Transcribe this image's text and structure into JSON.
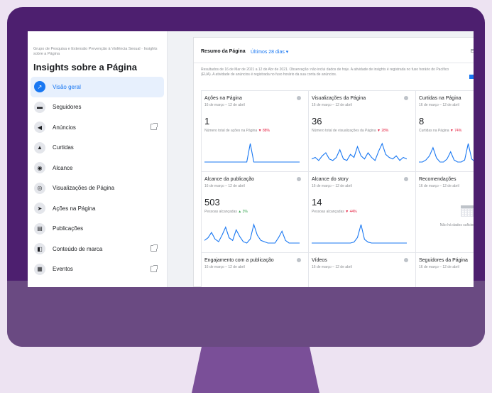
{
  "sidebar": {
    "breadcrumb": "Grupo de Pesquisa e Extensão Prevenção à Violência Sexual · Insights sobre a Página",
    "title": "Insights sobre a Página",
    "items": [
      {
        "label": "Visão geral",
        "icon": "overview-icon",
        "glyph": "↗",
        "active": true,
        "external": false
      },
      {
        "label": "Seguidores",
        "icon": "followers-icon",
        "glyph": "▬",
        "active": false,
        "external": false
      },
      {
        "label": "Anúncios",
        "icon": "megaphone-icon",
        "glyph": "◀",
        "active": false,
        "external": true
      },
      {
        "label": "Curtidas",
        "icon": "thumbs-up-icon",
        "glyph": "▲",
        "active": false,
        "external": false
      },
      {
        "label": "Alcance",
        "icon": "reach-icon",
        "glyph": "◉",
        "active": false,
        "external": false
      },
      {
        "label": "Visualizações de Página",
        "icon": "eye-icon",
        "glyph": "◎",
        "active": false,
        "external": false
      },
      {
        "label": "Ações na Página",
        "icon": "cursor-icon",
        "glyph": "➤",
        "active": false,
        "external": false
      },
      {
        "label": "Publicações",
        "icon": "posts-icon",
        "glyph": "▤",
        "active": false,
        "external": false
      },
      {
        "label": "Conteúdo de marca",
        "icon": "branded-content-icon",
        "glyph": "◧",
        "active": false,
        "external": true
      },
      {
        "label": "Eventos",
        "icon": "calendar-icon",
        "glyph": "▦",
        "active": false,
        "external": true
      }
    ]
  },
  "summary": {
    "title": "Resumo da Página",
    "range": "Últimos 28 dias ▾",
    "export": "Ex",
    "notice": "Resultados de 16 de Mar de 2021 a 12 de Abr de 2021. Observação: não inclui dados de hoje. A atividade de insights é registrada no fuso horário do Pacífico (EUA). A atividade de anúncios é registrada no fuso horário da sua conta de anúncios."
  },
  "cards": [
    {
      "title": "Ações na Página",
      "date": "16 de março – 12 de abril",
      "value": "1",
      "note": "Número total de ações na Página",
      "trend": "▼ 88%",
      "trend_dir": "down",
      "spark": [
        0,
        0,
        0,
        0,
        0,
        0,
        0,
        0,
        0,
        0,
        0,
        0,
        0,
        20,
        0,
        0,
        0,
        0,
        0,
        0,
        0,
        0,
        0,
        0,
        0,
        0,
        0,
        0
      ]
    },
    {
      "title": "Visualizações da Página",
      "date": "16 de março – 12 de abril",
      "value": "36",
      "note": "Número total de visualizações da Página",
      "trend": "▼ 28%",
      "trend_dir": "down",
      "spark": [
        2,
        3,
        1,
        4,
        6,
        2,
        1,
        3,
        8,
        2,
        1,
        5,
        3,
        10,
        4,
        2,
        6,
        3,
        1,
        7,
        12,
        5,
        3,
        2,
        4,
        1,
        3,
        2
      ]
    },
    {
      "title": "Curtidas na Página",
      "date": "16 de março – 12 de abril",
      "value": "8",
      "note": "Curtidas na Página",
      "trend": "▼ 74%",
      "trend_dir": "down",
      "spark": [
        0,
        0,
        2,
        6,
        14,
        4,
        0,
        0,
        3,
        10,
        2,
        0,
        0,
        2,
        18,
        3,
        0,
        0,
        4,
        12,
        0,
        0,
        0,
        6,
        0,
        0,
        0,
        0
      ]
    },
    {
      "title": "Alcance da publicação",
      "date": "16 de março – 12 de abril",
      "value": "503",
      "note": "Pessoas alcançadas",
      "trend": "▲ 3%",
      "trend_dir": "up",
      "spark": [
        2,
        4,
        8,
        3,
        1,
        6,
        12,
        4,
        2,
        10,
        5,
        1,
        0,
        3,
        14,
        6,
        2,
        1,
        0,
        0,
        0,
        4,
        9,
        2,
        0,
        0,
        0,
        0
      ]
    },
    {
      "title": "Alcance do story",
      "date": "16 de março – 12 de abril",
      "value": "14",
      "note": "Pessoas alcançadas",
      "trend": "▼ 44%",
      "trend_dir": "down",
      "spark": [
        0,
        0,
        0,
        0,
        0,
        0,
        0,
        0,
        0,
        0,
        0,
        0,
        1,
        6,
        20,
        4,
        1,
        0,
        0,
        0,
        0,
        0,
        0,
        0,
        0,
        0,
        0,
        0
      ]
    },
    {
      "title": "Recomendações",
      "date": "16 de março – 12 de abril",
      "value": "",
      "note": "",
      "trend": "",
      "trend_dir": "",
      "empty": true,
      "empty_text": "Não há dados suficientes para o período sele"
    },
    {
      "title": "Engajamento com a publicação",
      "date": "16 de março – 12 de abril",
      "value": "",
      "note": "",
      "trend": "",
      "trend_dir": "",
      "spark": []
    },
    {
      "title": "Vídeos",
      "date": "16 de março – 12 de abril",
      "value": "",
      "note": "",
      "trend": "",
      "trend_dir": "",
      "spark": []
    },
    {
      "title": "Seguidores da Página",
      "date": "16 de março – 12 de abril",
      "value": "",
      "note": "",
      "trend": "",
      "trend_dir": "",
      "spark": []
    }
  ],
  "colors": {
    "brand": "#1877f2",
    "monitor": "#4d1f6f",
    "down": "#e41e3f",
    "up": "#31a24c"
  }
}
